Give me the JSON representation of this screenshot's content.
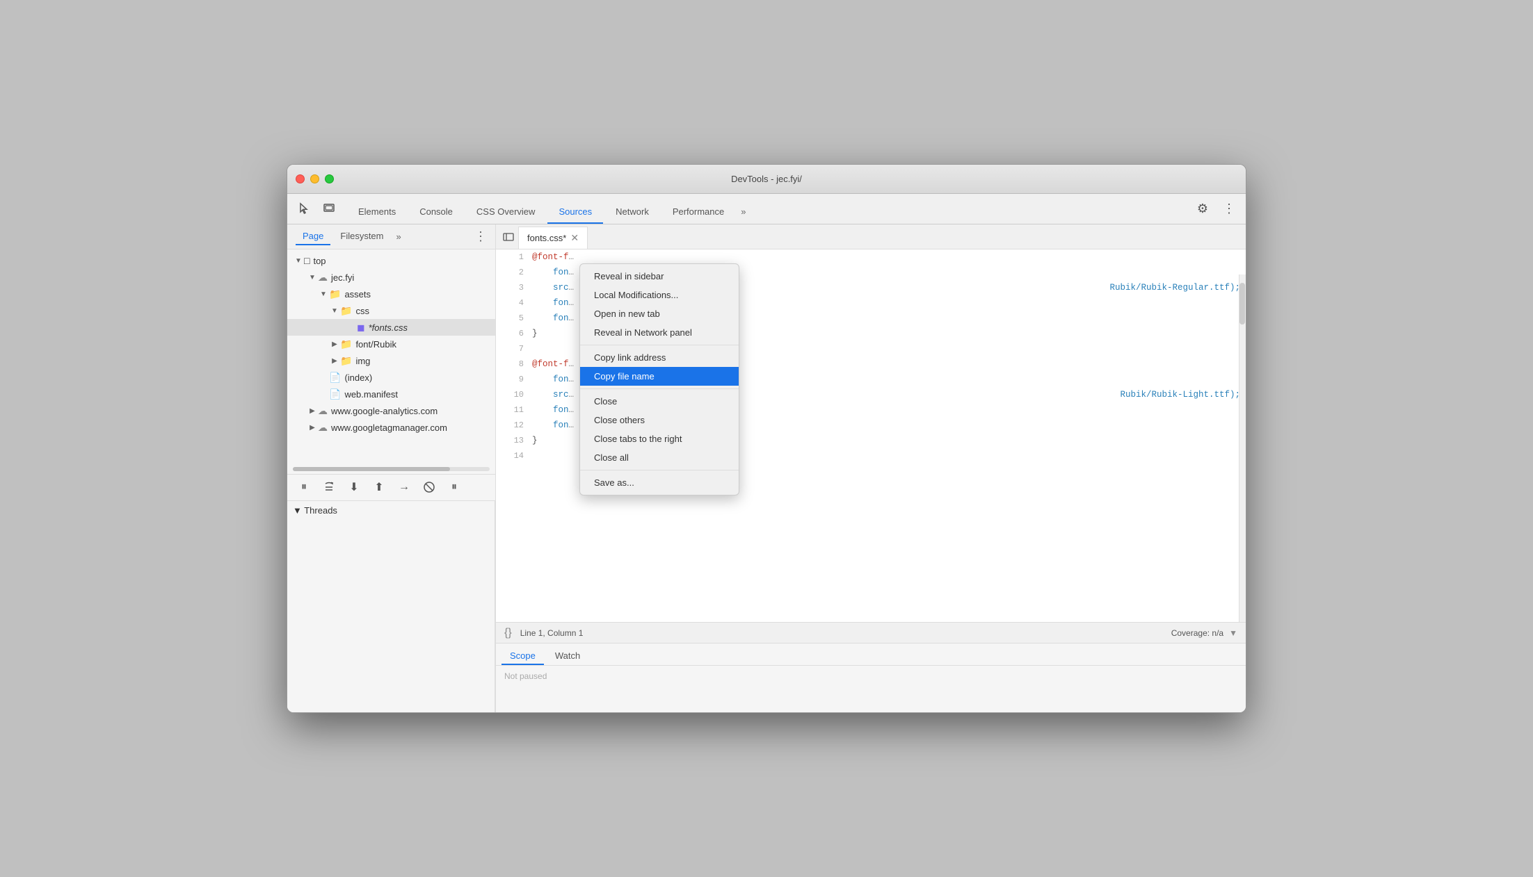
{
  "window": {
    "title": "DevTools - jec.fyi/"
  },
  "tabbar": {
    "icons": [
      "cursor",
      "layers"
    ],
    "tabs": [
      {
        "label": "Elements",
        "active": false
      },
      {
        "label": "Console",
        "active": false
      },
      {
        "label": "CSS Overview",
        "active": false
      },
      {
        "label": "Sources",
        "active": true
      },
      {
        "label": "Network",
        "active": false
      },
      {
        "label": "Performance",
        "active": false
      }
    ],
    "more": "»",
    "right_icons": [
      "gear",
      "kebab"
    ]
  },
  "sidebar": {
    "tabs": [
      {
        "label": "Page",
        "active": true
      },
      {
        "label": "Filesystem",
        "active": false
      }
    ],
    "more": "»",
    "tree": [
      {
        "indent": 0,
        "arrow": "▼",
        "icon": "□",
        "label": "top",
        "type": "folder-open"
      },
      {
        "indent": 1,
        "arrow": "▼",
        "icon": "☁",
        "label": "jec.fyi",
        "type": "cloud"
      },
      {
        "indent": 2,
        "arrow": "▼",
        "icon": "📁",
        "label": "assets",
        "type": "folder"
      },
      {
        "indent": 3,
        "arrow": "▼",
        "icon": "📁",
        "label": "css",
        "type": "folder"
      },
      {
        "indent": 4,
        "arrow": "",
        "icon": "📄",
        "label": "*fonts.css",
        "type": "file",
        "selected": true
      },
      {
        "indent": 3,
        "arrow": "▶",
        "icon": "📁",
        "label": "font/Rubik",
        "type": "folder"
      },
      {
        "indent": 3,
        "arrow": "▶",
        "icon": "📁",
        "label": "img",
        "type": "folder"
      },
      {
        "indent": 2,
        "arrow": "",
        "icon": "📄",
        "label": "(index)",
        "type": "file"
      },
      {
        "indent": 2,
        "arrow": "",
        "icon": "📄",
        "label": "web.manifest",
        "type": "file"
      },
      {
        "indent": 1,
        "arrow": "▶",
        "icon": "☁",
        "label": "www.google-analytics.com",
        "type": "cloud"
      },
      {
        "indent": 1,
        "arrow": "▶",
        "icon": "☁",
        "label": "www.googletagmanager.com",
        "type": "cloud"
      }
    ]
  },
  "editor": {
    "file_tab": "fonts.css*",
    "lines": [
      {
        "num": 1,
        "content": "@font-f",
        "truncated": true,
        "color": "red"
      },
      {
        "num": 2,
        "content": "    fon",
        "truncated": true,
        "color": "blue"
      },
      {
        "num": 3,
        "content": "    src",
        "truncated": true,
        "color": "blue",
        "extra": "Rubik/Rubik-Regular.ttf);"
      },
      {
        "num": 4,
        "content": "    fon",
        "truncated": true,
        "color": "blue"
      },
      {
        "num": 5,
        "content": "    fon",
        "truncated": true,
        "color": "blue"
      },
      {
        "num": 6,
        "content": "}",
        "color": "gray"
      },
      {
        "num": 7,
        "content": "",
        "color": "gray"
      },
      {
        "num": 8,
        "content": "@font-f",
        "truncated": true,
        "color": "red"
      },
      {
        "num": 9,
        "content": "    fon",
        "truncated": true,
        "color": "blue"
      },
      {
        "num": 10,
        "content": "    src",
        "truncated": true,
        "color": "blue",
        "extra": "Rubik/Rubik-Light.ttf);"
      },
      {
        "num": 11,
        "content": "    fon",
        "truncated": true,
        "color": "blue"
      },
      {
        "num": 12,
        "content": "    fon",
        "truncated": true,
        "color": "blue"
      },
      {
        "num": 13,
        "content": "}",
        "color": "gray"
      },
      {
        "num": 14,
        "content": "",
        "color": "gray"
      }
    ]
  },
  "context_menu": {
    "items": [
      {
        "label": "Reveal in sidebar",
        "type": "normal"
      },
      {
        "label": "Local Modifications...",
        "type": "normal"
      },
      {
        "label": "Open in new tab",
        "type": "normal"
      },
      {
        "label": "Reveal in Network panel",
        "type": "normal"
      },
      {
        "label": "separator1",
        "type": "separator"
      },
      {
        "label": "Copy link address",
        "type": "normal"
      },
      {
        "label": "Copy file name",
        "type": "highlighted"
      },
      {
        "label": "separator2",
        "type": "separator"
      },
      {
        "label": "Close",
        "type": "normal"
      },
      {
        "label": "Close others",
        "type": "normal"
      },
      {
        "label": "Close tabs to the right",
        "type": "normal"
      },
      {
        "label": "Close all",
        "type": "normal"
      },
      {
        "label": "separator3",
        "type": "separator"
      },
      {
        "label": "Save as...",
        "type": "normal"
      }
    ]
  },
  "bottom_bar": {
    "curly": "{}",
    "position": "Line 1, Column 1",
    "coverage": "Coverage: n/a",
    "coverage_icon": "▼"
  },
  "debugger": {
    "buttons": [
      "⏸",
      "↺",
      "⬇",
      "⬆",
      "→",
      "✕",
      "⏸"
    ]
  },
  "panel_bottom": {
    "left": {
      "threads_label": "▼ Threads"
    },
    "right": {
      "tabs": [
        {
          "label": "Scope",
          "active": true
        },
        {
          "label": "Watch",
          "active": false
        }
      ],
      "content": "Not paused"
    }
  }
}
